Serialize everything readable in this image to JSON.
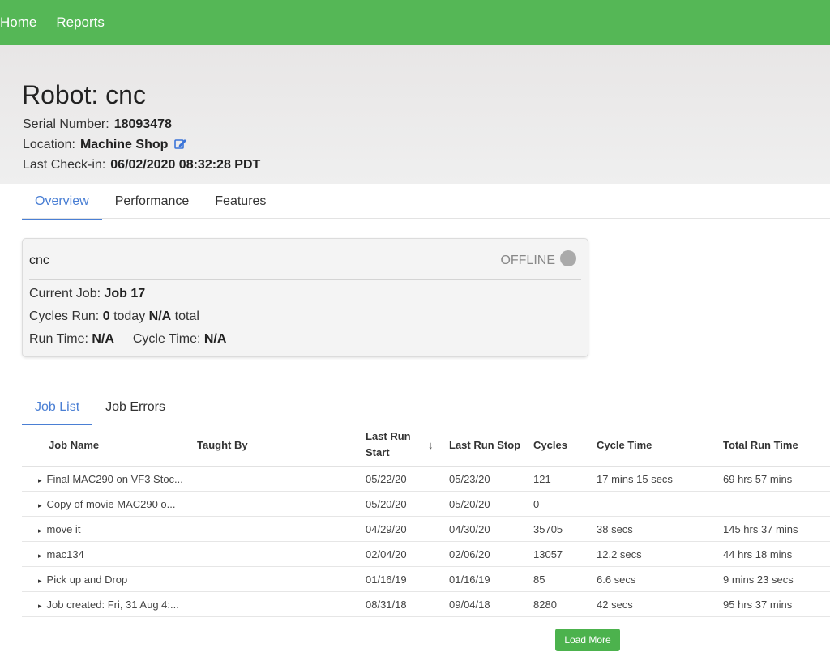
{
  "nav": {
    "home": "Home",
    "reports": "Reports"
  },
  "robot": {
    "title": "Robot: cnc",
    "serial_label": "Serial Number:",
    "serial_value": "18093478",
    "location_label": "Location:",
    "location_value": "Machine Shop",
    "checkin_label": "Last Check-in:",
    "checkin_value": "06/02/2020 08:32:28 PDT"
  },
  "tabs": [
    "Overview",
    "Performance",
    "Features"
  ],
  "card": {
    "name": "cnc",
    "status": "OFFLINE",
    "current_job_label": "Current Job:",
    "current_job_value": "Job 17",
    "cycles_label": "Cycles Run:",
    "cycles_today_value": "0",
    "cycles_today_word": "today",
    "cycles_total_value": "N/A",
    "cycles_total_word": "total",
    "run_time_label": "Run Time:",
    "run_time_value": "N/A",
    "cycle_time_label": "Cycle Time:",
    "cycle_time_value": "N/A"
  },
  "job_tabs": [
    "Job List",
    "Job Errors"
  ],
  "table": {
    "headers": {
      "job_name": "Job Name",
      "taught_by": "Taught By",
      "last_run_start": "Last Run Start",
      "sort_indicator": "↓",
      "last_run_stop": "Last Run Stop",
      "cycles": "Cycles",
      "cycle_time": "Cycle Time",
      "total_run_time": "Total Run Time"
    },
    "rows": [
      {
        "name": "Final MAC290 on VF3 Stoc...",
        "taught_by": "",
        "start": "05/22/20",
        "stop": "05/23/20",
        "cycles": "121",
        "cycle_time": "17 mins 15 secs",
        "total": "69 hrs 57 mins"
      },
      {
        "name": "Copy of movie MAC290 o...",
        "taught_by": "",
        "start": "05/20/20",
        "stop": "05/20/20",
        "cycles": "0",
        "cycle_time": "",
        "total": ""
      },
      {
        "name": "move it",
        "taught_by": "",
        "start": "04/29/20",
        "stop": "04/30/20",
        "cycles": "35705",
        "cycle_time": "38 secs",
        "total": "145 hrs 37 mins"
      },
      {
        "name": "mac134",
        "taught_by": "",
        "start": "02/04/20",
        "stop": "02/06/20",
        "cycles": "13057",
        "cycle_time": "12.2 secs",
        "total": "44 hrs 18 mins"
      },
      {
        "name": "Pick up and Drop",
        "taught_by": "",
        "start": "01/16/19",
        "stop": "01/16/19",
        "cycles": "85",
        "cycle_time": "6.6 secs",
        "total": "9 mins 23 secs"
      },
      {
        "name": "Job created: Fri, 31 Aug 4:...",
        "taught_by": "",
        "start": "08/31/18",
        "stop": "09/04/18",
        "cycles": "8280",
        "cycle_time": "42 secs",
        "total": "95 hrs 37 mins"
      }
    ]
  },
  "load_more_label": "Load More",
  "colors": {
    "nav_green": "#55b756",
    "accent_blue": "#4a7fd4",
    "button_green": "#4cb24d",
    "status_gray": "#aaaaaa"
  },
  "icons": {
    "edit": "edit-icon",
    "expand": "triangle-right-icon",
    "status": "status-dot-icon"
  }
}
